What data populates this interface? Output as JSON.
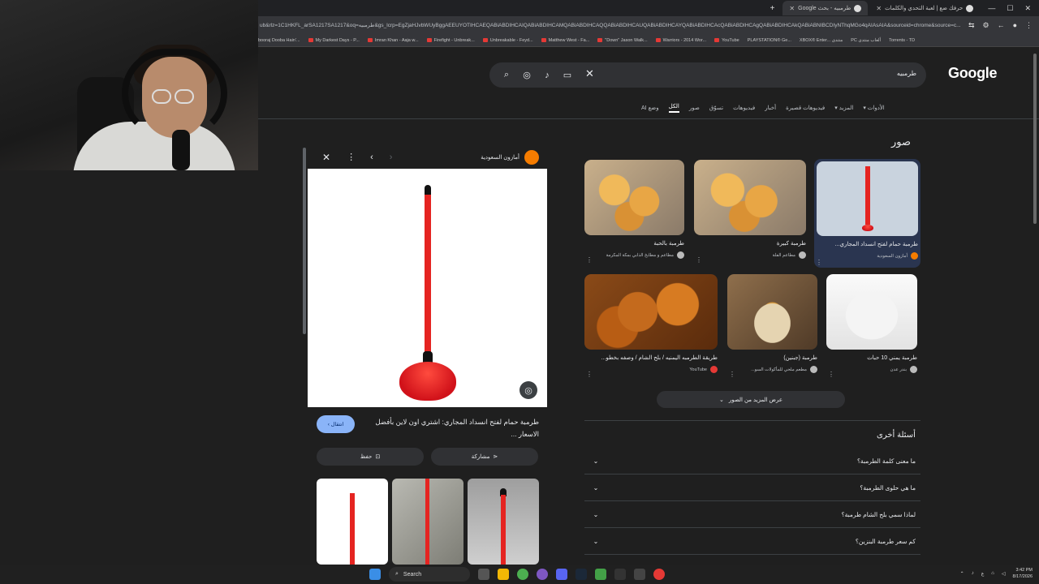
{
  "browser": {
    "tabs": [
      {
        "title": "حرفك ضع | لعبة التحدي والكلمات",
        "active": false
      },
      {
        "title": "طرمبيه - بحث Google",
        "active": true
      }
    ],
    "new_tab": "+",
    "url": "ub&rlz=1C1HKFL_arSA1217SA1217&oq=طرمبيه&gs_lcrp=EgZjaHJvbWUyBggAEEUYOTIHCAEQABiABDIHCAIQABiABDIHCAMQABiABDIHCAQQABiABDIHCAUQABiABDIHCAYQABiABDIHCAcQABiABDIHCAgQABiABDIHCAkQABiABNIBCDIyNThqMGo4qAIAsAIA&sourceid=chrome&source=c...",
    "bookmarks": [
      "booraj Dooba Hain'...",
      "My Darkest Days - P...",
      "Imran Khan - Aaja w...",
      "Firefight - Unbreak...",
      "Unbreakable - Feyd...",
      "Matthew West - Fa...",
      "\"Down\" Jason Walk...",
      "Warriors - 2014 Wor...",
      "YouTube",
      "PLAYSTATION® Ge...",
      "XBOX® Enter... منتدى",
      "PC ألعاب منتدى",
      "Torrents - TD"
    ]
  },
  "google": {
    "logo": "Google",
    "query": "طرمبيه",
    "tabs": [
      "وضع AI",
      "الكل",
      "صور",
      "تسوّق",
      "فيديوهات",
      "أخبار",
      "فيديوهات قصيرة",
      "المزيد",
      "الأدوات"
    ],
    "active_tab": "الكل"
  },
  "images": {
    "heading": "صور",
    "cards": [
      {
        "caption": "طرمبة حمام لفتح انسداد المجاري...",
        "source": "أمازون السعودية"
      },
      {
        "caption": "طرمبة كبيرة",
        "source": "مطاعم الفلة"
      },
      {
        "caption": "طرمبة بالحبة",
        "source": "مطاعم و مطابخ الذابي بمكة المكرمة"
      },
      {
        "caption": "طرمبة يمني 10 حبات",
        "source": "بندر عدن"
      },
      {
        "caption": "طرمبة (جبنين)",
        "source": "مطعم ملحي للمأكولات السو..."
      },
      {
        "caption": "طريقة الطرمبه اليمنيه / بلح الشام / وصفه بخطو...",
        "source": "YouTube"
      }
    ],
    "more_button": "عرض المزيد من الصور"
  },
  "paa": {
    "heading": "أسئلة أخرى",
    "questions": [
      "ما معنى كلمة الطرمبة؟",
      "ما هي حلوى الطرمبة؟",
      "لماذا سمي بلح الشام طرمبة؟",
      "كم سعر طرمبة البنزين؟"
    ]
  },
  "preview": {
    "source": "أمازون السعودية",
    "title": "طرمبة حمام لفتح انسداد المجاري: اشتري اون لاين بأفضل الاسعار ...",
    "visit": "انتقال",
    "save": "حفظ",
    "share": "مشاركة"
  },
  "taskbar": {
    "search": "Search",
    "time": "3:42 PM",
    "date": "8/17/2026",
    "lang": "ع"
  },
  "colors": {
    "page_bg": "#1f1f1f",
    "accent_blue": "#8ab4f8",
    "plunger_red": "#e52421",
    "source_orange": "#f57c00"
  }
}
